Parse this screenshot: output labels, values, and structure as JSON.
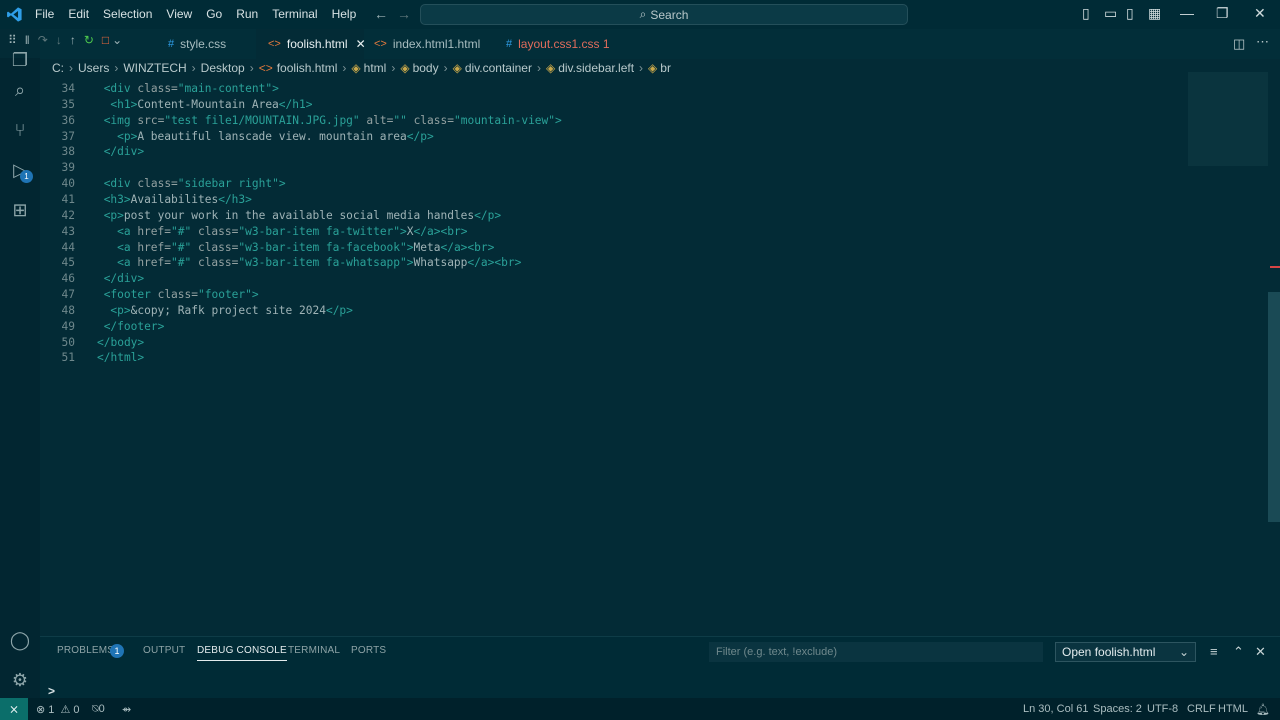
{
  "menu": [
    "File",
    "Edit",
    "Selection",
    "View",
    "Go",
    "Run",
    "Terminal",
    "Help"
  ],
  "search": {
    "label": "Search"
  },
  "tabs": [
    {
      "label": "style.css",
      "icon": "#",
      "active": false
    },
    {
      "label": "foolish.html",
      "icon": "<>",
      "active": true,
      "close": "✕"
    },
    {
      "label": "index.html1.html",
      "icon": "<>",
      "active": false
    },
    {
      "label": "layout.css1.css 1",
      "icon": "#",
      "active": false
    }
  ],
  "breadcrumb": [
    "C:",
    "Users",
    "WINZTECH",
    "Desktop",
    "foolish.html",
    "html",
    "body",
    "div.container",
    "div.sidebar.left",
    "br"
  ],
  "code_lines": [
    {
      "n": "34",
      "indent": 1
    },
    {
      "n": "35",
      "indent": 2
    },
    {
      "n": "36",
      "indent": 1
    },
    {
      "n": "37",
      "indent": 3
    },
    {
      "n": "38",
      "indent": 1
    },
    {
      "n": "39",
      "indent": 0
    },
    {
      "n": "40",
      "indent": 1
    },
    {
      "n": "41",
      "indent": 1
    },
    {
      "n": "42",
      "indent": 1
    },
    {
      "n": "43",
      "indent": 3
    },
    {
      "n": "44",
      "indent": 3
    },
    {
      "n": "45",
      "indent": 3
    },
    {
      "n": "46",
      "indent": 1
    },
    {
      "n": "47",
      "indent": 1
    },
    {
      "n": "48",
      "indent": 2
    },
    {
      "n": "49",
      "indent": 1
    },
    {
      "n": "50",
      "indent": 0
    },
    {
      "n": "51",
      "indent": 0
    }
  ],
  "code_text": {
    "l34": [
      "<div",
      " class=",
      "\"main-content\"",
      ">"
    ],
    "l35": [
      "<h1>",
      "Content-Mountain Area",
      "</h1>"
    ],
    "l36": [
      "<img",
      " src=",
      "\"test file1/MOUNTAIN.JPG.jpg\"",
      " alt=",
      "\"\"",
      " class=",
      "\"mountain-view\"",
      ">"
    ],
    "l37": [
      "<p>",
      "A beautiful lanscade view. mountain area",
      "</p>"
    ],
    "l38": [
      "</div>"
    ],
    "l40": [
      "<div",
      " class=",
      "\"sidebar right\"",
      ">"
    ],
    "l41": [
      "<h3>",
      "Availabilites",
      "</h3>"
    ],
    "l42": [
      "<p>",
      "post your work in the available social media handles",
      "</p>"
    ],
    "l43": [
      "<a",
      " href=",
      "\"#\"",
      " class=",
      "\"w3-bar-item fa-twitter\"",
      ">",
      "X",
      "</a>",
      "<br>"
    ],
    "l44": [
      "<a",
      " href=",
      "\"#\"",
      " class=",
      "\"w3-bar-item fa-facebook\"",
      ">",
      "Meta",
      "</a>",
      "<br>"
    ],
    "l45": [
      "<a",
      " href=",
      "\"#\"",
      " class=",
      "\"w3-bar-item fa-whatsapp\"",
      ">",
      "Whatsapp",
      "</a>",
      "<br>"
    ],
    "l46": [
      "</div>"
    ],
    "l47": [
      "<footer",
      " class=",
      "\"footer\"",
      ">"
    ],
    "l48": [
      "<p>",
      "&copy;",
      " Rafk project site 2024",
      "</p>"
    ],
    "l49": [
      "</footer>"
    ],
    "l50": [
      "</body>"
    ],
    "l51": [
      "</html>"
    ]
  },
  "panel": {
    "tabs": [
      "PROBLEMS",
      "OUTPUT",
      "DEBUG CONSOLE",
      "TERMINAL",
      "PORTS"
    ],
    "problems_count": "1",
    "filter_placeholder": "Filter (e.g. text, !exclude)",
    "config": "Open foolish.html",
    "prompt": ">"
  },
  "status": {
    "errors": "1",
    "warnings": "0",
    "ports": "0",
    "position": "Ln 30, Col 61",
    "spaces": "Spaces: 2",
    "encoding": "UTF-8",
    "eol": "CRLF",
    "language": "HTML"
  },
  "activity_badge": "1",
  "colors": {
    "accent": "#2aa198",
    "background": "#032b36",
    "badge": "#1f74b5"
  }
}
